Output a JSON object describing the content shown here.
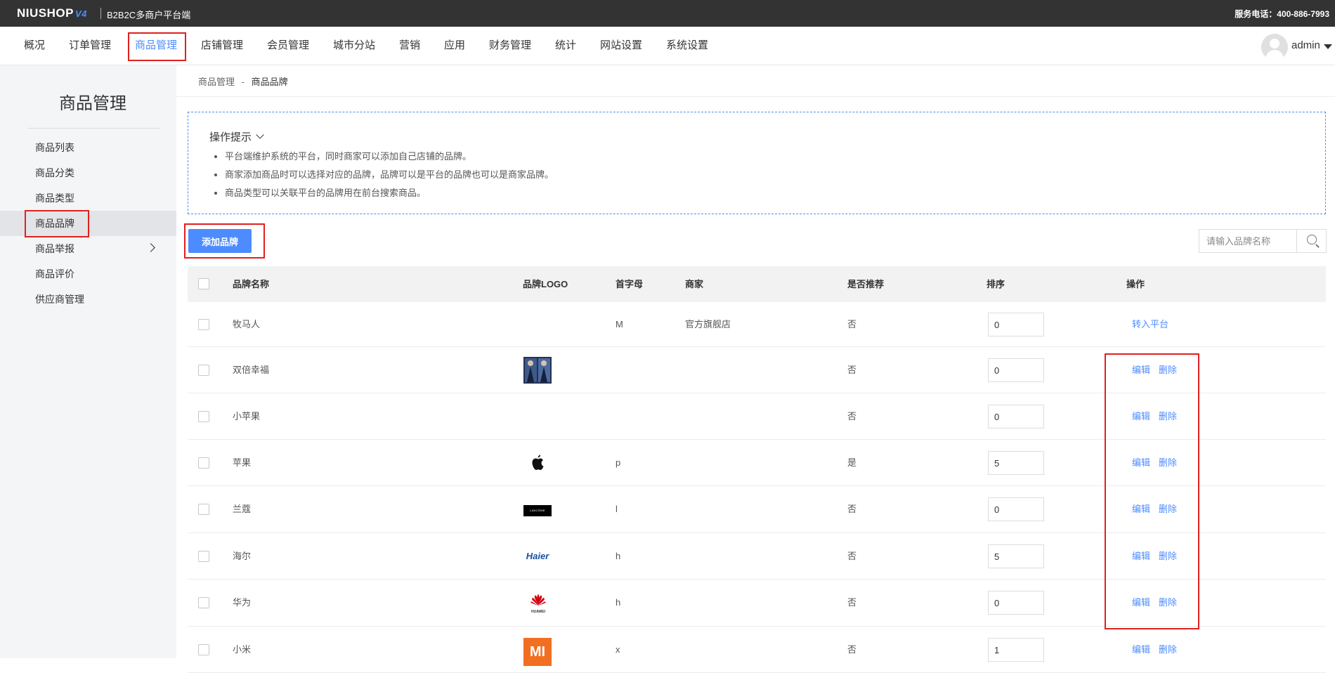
{
  "topbar": {
    "logo_text": "NIUSHOP",
    "logo_version": "V4",
    "subtitle": "B2B2C多商户平台端",
    "hotline_label": "服务电话：",
    "hotline_number": "400-886-7993"
  },
  "nav": {
    "items": [
      "概况",
      "订单管理",
      "商品管理",
      "店铺管理",
      "会员管理",
      "城市分站",
      "营销",
      "应用",
      "财务管理",
      "统计",
      "网站设置",
      "系统设置"
    ],
    "active_index": 2,
    "user_name": "admin"
  },
  "sidebar": {
    "title": "商品管理",
    "items": [
      "商品列表",
      "商品分类",
      "商品类型",
      "商品品牌",
      "商品举报",
      "商品评价",
      "供应商管理"
    ],
    "active_index": 3
  },
  "breadcrumb": {
    "parent": "商品管理",
    "separator": "-",
    "current": "商品品牌"
  },
  "tips": {
    "title": "操作提示",
    "items": [
      "平台端维护系统的平台，同时商家可以添加自己店铺的品牌。",
      "商家添加商品时可以选择对应的品牌，品牌可以是平台的品牌也可以是商家品牌。",
      "商品类型可以关联平台的品牌用在前台搜索商品。"
    ]
  },
  "toolbar": {
    "add_label": "添加品牌",
    "search_placeholder": "请输入品牌名称"
  },
  "table": {
    "headers": {
      "name": "品牌名称",
      "logo": "品牌LOGO",
      "initial": "首字母",
      "merchant": "商家",
      "recommend": "是否推荐",
      "sort": "排序",
      "action": "操作"
    },
    "rows": [
      {
        "name": "牧马人",
        "logo": "",
        "initial": "M",
        "merchant": "官方旗舰店",
        "recommend": "否",
        "sort": "0",
        "actions": [
          "转入平台"
        ]
      },
      {
        "name": "双倍幸福",
        "logo": "photo-logo",
        "initial": "",
        "merchant": "",
        "recommend": "否",
        "sort": "0",
        "actions": [
          "编辑",
          "删除"
        ]
      },
      {
        "name": "小苹果",
        "logo": "",
        "initial": "",
        "merchant": "",
        "recommend": "否",
        "sort": "0",
        "actions": [
          "编辑",
          "删除"
        ]
      },
      {
        "name": "苹果",
        "logo": "apple-logo",
        "initial": "p",
        "merchant": "",
        "recommend": "是",
        "sort": "5",
        "actions": [
          "编辑",
          "删除"
        ]
      },
      {
        "name": "兰蔻",
        "logo": "lancome-logo",
        "initial": "l",
        "merchant": "",
        "recommend": "否",
        "sort": "0",
        "actions": [
          "编辑",
          "删除"
        ]
      },
      {
        "name": "海尔",
        "logo": "haier-logo",
        "initial": "h",
        "merchant": "",
        "recommend": "否",
        "sort": "5",
        "actions": [
          "编辑",
          "删除"
        ]
      },
      {
        "name": "华为",
        "logo": "huawei-logo",
        "initial": "h",
        "merchant": "",
        "recommend": "否",
        "sort": "0",
        "actions": [
          "编辑",
          "删除"
        ]
      },
      {
        "name": "小米",
        "logo": "mi-logo",
        "initial": "x",
        "merchant": "",
        "recommend": "否",
        "sort": "1",
        "actions": [
          "编辑",
          "删除"
        ]
      }
    ],
    "logo_texts": {
      "haier": "Haier",
      "lancome": "LANCÔME",
      "huawei": "HUAWEI",
      "mi": "MI"
    }
  },
  "colors": {
    "accent": "#4d8cff",
    "highlight": "#e02020",
    "topbar": "#333333"
  }
}
